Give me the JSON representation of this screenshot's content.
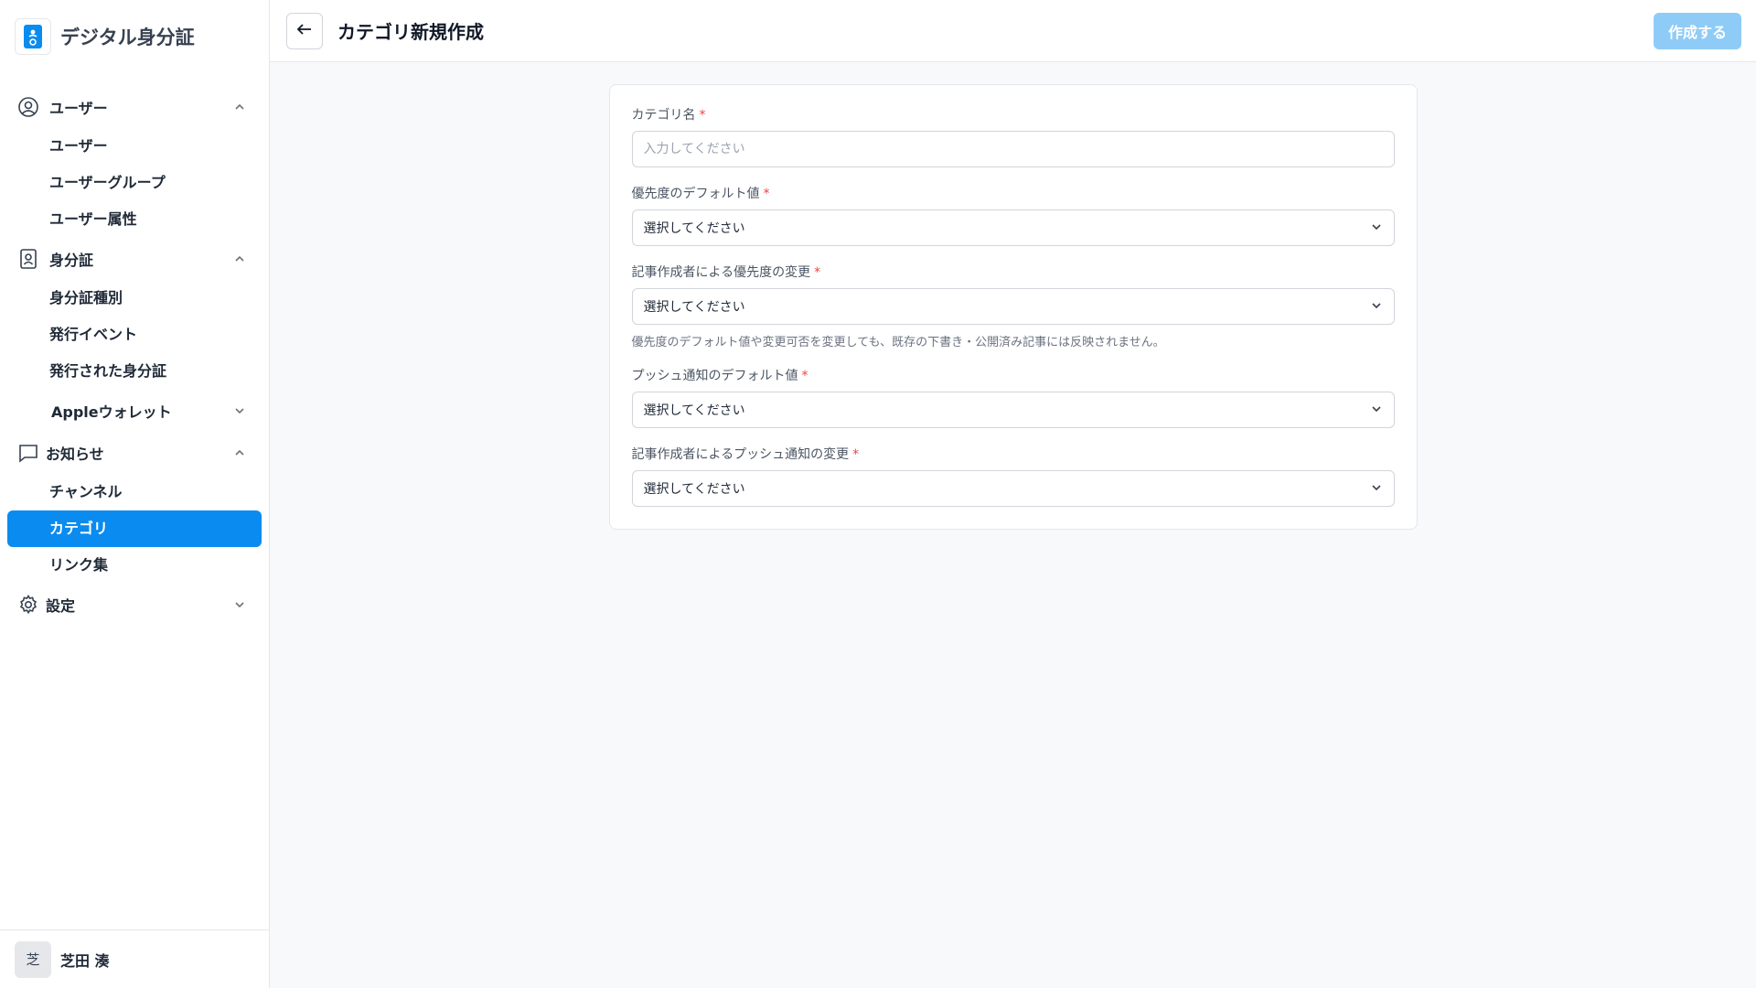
{
  "brand": {
    "title": "デジタル身分証"
  },
  "sidebar": {
    "sections": [
      {
        "label": "ユーザー",
        "icon": "user-circle-icon",
        "items": [
          "ユーザー",
          "ユーザーグループ",
          "ユーザー属性"
        ]
      },
      {
        "label": "身分証",
        "icon": "id-card-icon",
        "items": [
          "身分証種別",
          "発行イベント",
          "発行された身分証"
        ]
      },
      {
        "label": "Appleウォレット"
      },
      {
        "label": "お知らせ",
        "icon": "chat-bubble-icon",
        "items": [
          "チャンネル",
          "カテゴリ",
          "リンク集"
        ]
      },
      {
        "label": "設定",
        "icon": "gear-icon"
      }
    ],
    "active_item": "カテゴリ",
    "user": {
      "initial": "芝",
      "name": "芝田 湊"
    }
  },
  "header": {
    "title": "カテゴリ新規作成",
    "create_label": "作成する"
  },
  "form": {
    "required_mark": "*",
    "category_name": {
      "label": "カテゴリ名",
      "placeholder": "入力してください",
      "value": ""
    },
    "priority_default": {
      "label": "優先度のデフォルト値",
      "value": "選択してください"
    },
    "priority_change": {
      "label": "記事作成者による優先度の変更",
      "value": "選択してください",
      "help": "優先度のデフォルト値や変更可否を変更しても、既存の下書き・公開済み記事には反映されません。"
    },
    "push_default": {
      "label": "プッシュ通知のデフォルト値",
      "value": "選択してください"
    },
    "push_change": {
      "label": "記事作成者によるプッシュ通知の変更",
      "value": "選択してください"
    }
  },
  "colors": {
    "accent": "#0a8bf0",
    "accent_disabled": "#8fcbf7",
    "required": "#ef4444"
  }
}
